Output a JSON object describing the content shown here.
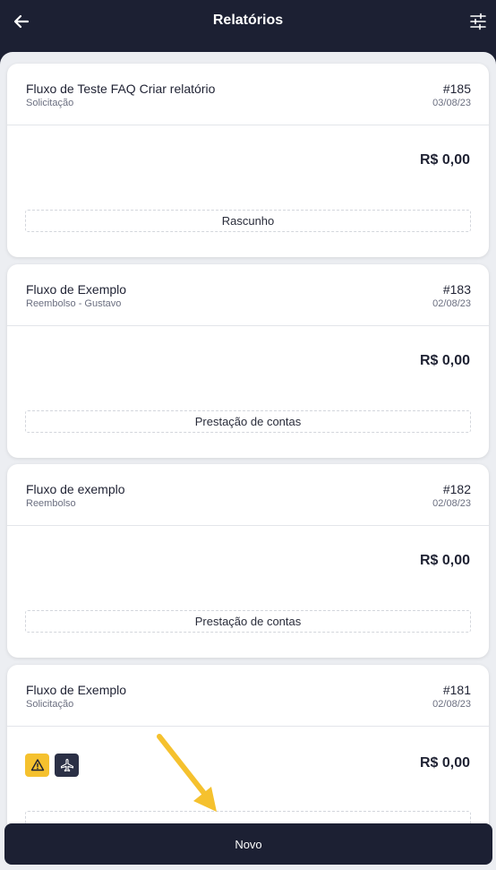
{
  "header": {
    "title": "Relatórios",
    "back_icon": "arrow-left-icon",
    "filter_icon": "sliders-icon"
  },
  "reports": [
    {
      "name": "Fluxo de Teste FAQ Criar relatório",
      "type": "Solicitação",
      "number": "#185",
      "date": "03/08/23",
      "amount": "R$ 0,00",
      "status": "Rascunho"
    },
    {
      "name": "Fluxo de Exemplo",
      "type": "Reembolso - Gustavo",
      "number": "#183",
      "date": "02/08/23",
      "amount": "R$ 0,00",
      "status": "Prestação de contas"
    },
    {
      "name": "Fluxo de exemplo",
      "type": "Reembolso",
      "number": "#182",
      "date": "02/08/23",
      "amount": "R$ 0,00",
      "status": "Prestação de contas"
    },
    {
      "name": "Fluxo de Exemplo",
      "type": "Solicitação",
      "number": "#181",
      "date": "02/08/23",
      "amount": "R$ 0,00",
      "badges": [
        "warning-icon",
        "airplane-icon"
      ]
    }
  ],
  "footer": {
    "new_label": "Novo"
  },
  "colors": {
    "header_bg": "#1c2033",
    "background": "#eceef2",
    "warning_badge": "#f5c12e",
    "plane_badge": "#2b3046",
    "arrow": "#f5c12e"
  }
}
